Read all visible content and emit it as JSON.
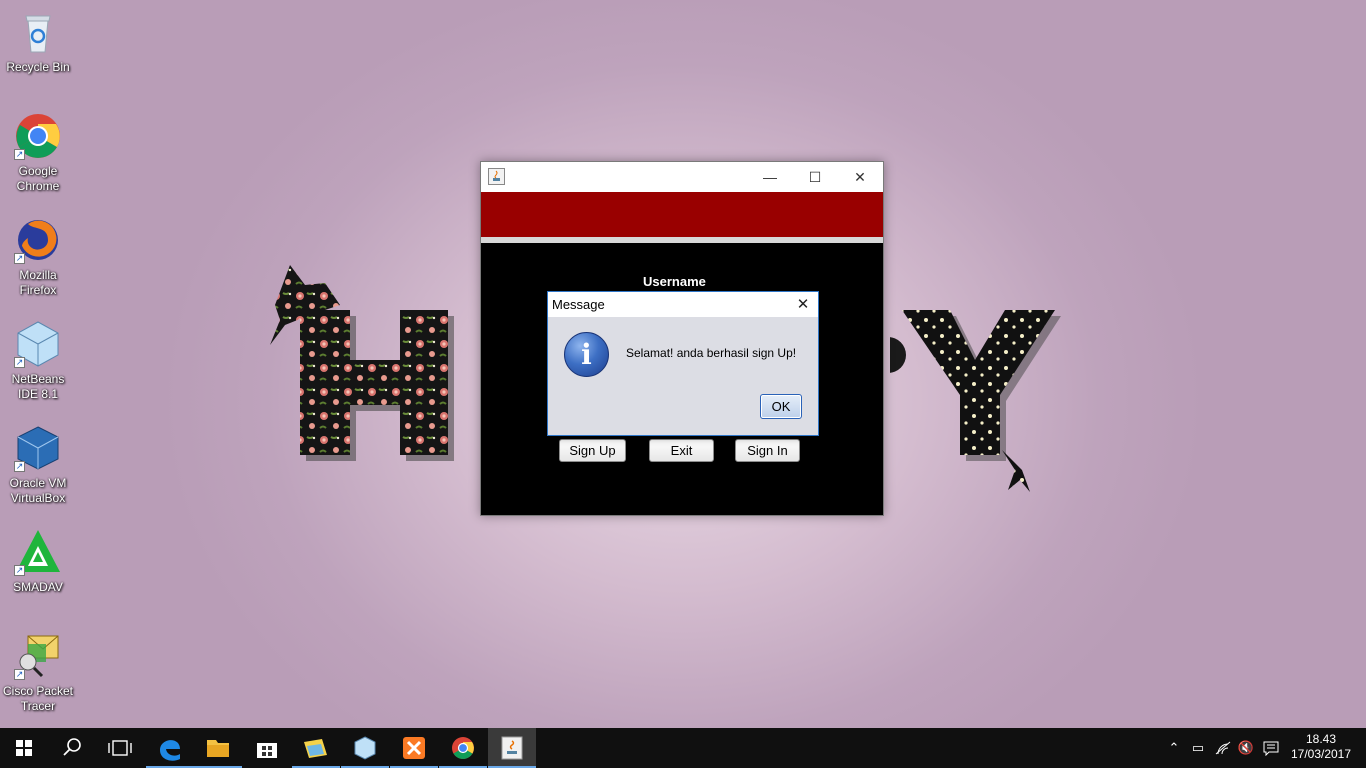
{
  "desktop": {
    "icons": [
      {
        "label": "Recycle Bin"
      },
      {
        "label": "Google Chrome"
      },
      {
        "label": "Mozilla Firefox"
      },
      {
        "label": "NetBeans IDE 8.1"
      },
      {
        "label": "Oracle VM VirtualBox"
      },
      {
        "label": "SMADAV"
      },
      {
        "label": "Cisco Packet Tracer"
      }
    ]
  },
  "app_window": {
    "form": {
      "username_label": "Username"
    },
    "buttons": {
      "sign_up": "Sign Up",
      "exit": "Exit",
      "sign_in": "Sign In"
    },
    "colors": {
      "banner": "#990000",
      "body": "#000000"
    }
  },
  "dialog": {
    "title": "Message",
    "message": "Selamat! anda berhasil sign Up!",
    "ok_label": "OK",
    "icon": "info-icon"
  },
  "taskbar": {
    "apps": [
      "start",
      "search",
      "task-view",
      "edge",
      "file-explorer",
      "store",
      "photos",
      "netbeans",
      "xampp",
      "chrome",
      "java"
    ],
    "clock": {
      "time": "18.43",
      "date": "17/03/2017"
    }
  }
}
